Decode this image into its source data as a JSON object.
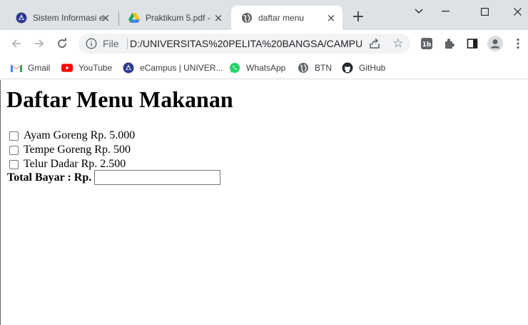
{
  "tabs": [
    {
      "title": "Sistem Informasi e",
      "icon": "campus-logo-icon",
      "active": false
    },
    {
      "title": "Praktikum 5.pdf - ",
      "icon": "google-drive-icon",
      "active": false
    },
    {
      "title": "daftar menu",
      "icon": "globe-icon",
      "active": true
    }
  ],
  "toolbar": {
    "file_label": "File",
    "url": "D:/UNIVERSITAS%20PELITA%20BANGSA/CAMPUR..."
  },
  "bookmarks": [
    {
      "label": "Gmail",
      "icon": "gmail-icon"
    },
    {
      "label": "YouTube",
      "icon": "youtube-icon"
    },
    {
      "label": "eCampus | UNIVER...",
      "icon": "campus-logo-icon"
    },
    {
      "label": "WhatsApp",
      "icon": "whatsapp-icon"
    },
    {
      "label": "BTN",
      "icon": "globe-icon"
    },
    {
      "label": "GitHub",
      "icon": "github-icon"
    }
  ],
  "page": {
    "heading": "Daftar Menu Makanan",
    "items": [
      {
        "label": "Ayam Goreng Rp. 5.000",
        "checked": false
      },
      {
        "label": "Tempe Goreng Rp. 500",
        "checked": false
      },
      {
        "label": "Telur Dadar Rp. 2.500",
        "checked": false
      }
    ],
    "total_label": "Total Bayar : Rp.",
    "total_value": ""
  },
  "colors": {
    "tabstrip_bg": "#dee1e6",
    "omnibox_bg": "#f1f3f4",
    "youtube_red": "#ff0000",
    "whatsapp_green": "#25d366"
  }
}
